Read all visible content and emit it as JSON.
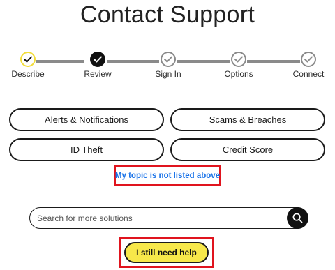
{
  "page": {
    "title": "Contact Support"
  },
  "stepper": {
    "steps": [
      {
        "label": "Describe",
        "state": "current"
      },
      {
        "label": "Review",
        "state": "done"
      },
      {
        "label": "Sign In",
        "state": "pending"
      },
      {
        "label": "Options",
        "state": "pending"
      },
      {
        "label": "Connect",
        "state": "pending"
      }
    ]
  },
  "topics": {
    "alerts": "Alerts & Notifications",
    "scams": "Scams & Breaches",
    "id_theft": "ID Theft",
    "credit_score": "Credit Score"
  },
  "not_listed_link": "My topic is not listed above",
  "search": {
    "placeholder": "Search for more solutions",
    "value": ""
  },
  "help_button": "I still need help",
  "colors": {
    "accent_yellow": "#f7e84a",
    "current_ring": "#f2dd3a",
    "link_blue": "#1a73e8",
    "highlight_red": "#e0141e",
    "pending_gray": "#8a8a8a"
  }
}
